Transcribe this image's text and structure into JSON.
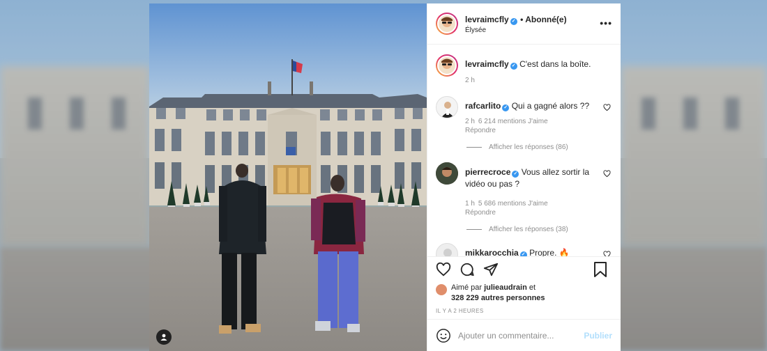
{
  "post": {
    "author": {
      "username": "levraimcfly",
      "verified": true,
      "follow_status": "• Abonné(e)",
      "location": "Élysée"
    },
    "caption": {
      "username": "levraimcfly",
      "text": "C'est dans la boîte.",
      "time": "2 h"
    },
    "comments": [
      {
        "username": "rafcarlito",
        "text": "Qui a gagné alors ??",
        "time": "2 h",
        "likes": "6 214 mentions J'aime",
        "reply_label": "Répondre",
        "view_replies": "Afficher les réponses (86)"
      },
      {
        "username": "pierrecroce",
        "text": "Vous allez sortir la vidéo ou pas ?",
        "time": "1 h",
        "likes": "5 686 mentions J'aime",
        "reply_label": "Répondre",
        "view_replies": "Afficher les réponses (38)"
      },
      {
        "username": "mikkarocchia",
        "text": "Propre. 🔥"
      }
    ],
    "liked_by": {
      "prefix": "Aimé par",
      "user": "julieaudrain",
      "connector": "et",
      "others": "328 229 autres personnes"
    },
    "timestamp": "IL Y A 2 HEURES",
    "add_comment": {
      "placeholder": "Ajouter un commentaire...",
      "publish_label": "Publier"
    },
    "more_options": "•••"
  },
  "colors": {
    "verified": "#3897f0",
    "text": "#262626",
    "muted": "#8e8e8e",
    "publish_disabled": "#b2dffc"
  }
}
